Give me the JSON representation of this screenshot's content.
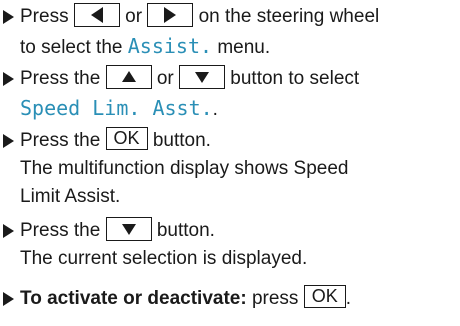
{
  "colors": {
    "text": "#1a1a1a",
    "display_text": "#2a8fb6"
  },
  "steps": [
    {
      "a": "Press",
      "key_left_icon": "left-triangle-icon",
      "b": "or",
      "key_right_icon": "right-triangle-icon",
      "c": "on the steering wheel",
      "d": "to select the",
      "menu": "Assist.",
      "e": "menu."
    },
    {
      "a": "Press the",
      "key_up_icon": "up-triangle-icon",
      "b": "or",
      "key_down_icon": "down-triangle-icon",
      "c": "button to select",
      "menu": "Speed Lim. Asst.",
      "d": "."
    },
    {
      "a": "Press the",
      "key": "OK",
      "b": "button.",
      "result1": "The multifunction display shows Speed",
      "result2": "Limit Assist."
    },
    {
      "a": "Press the",
      "key_down_icon": "down-triangle-icon",
      "b": "button.",
      "result": "The current selection is displayed."
    },
    {
      "bold": "To activate or deactivate:",
      "a": "press",
      "key": "OK",
      "b": "."
    }
  ]
}
